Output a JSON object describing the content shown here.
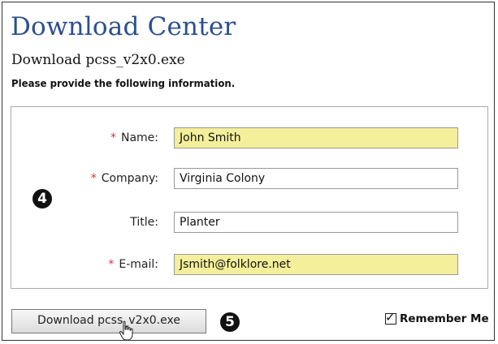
{
  "page": {
    "title": "Download Center",
    "subtitle": "Download pcss_v2x0.exe",
    "instruction": "Please provide the following information."
  },
  "form": {
    "required_marker": "*",
    "fields": [
      {
        "label": "Name:",
        "value": "John Smith",
        "required": true,
        "highlighted": true
      },
      {
        "label": "Company:",
        "value": "Virginia Colony",
        "required": true,
        "highlighted": false
      },
      {
        "label": "Title:",
        "value": "Planter",
        "required": false,
        "highlighted": false
      },
      {
        "label": "E-mail:",
        "value": "Jsmith@folklore.net",
        "required": true,
        "highlighted": true
      }
    ]
  },
  "actions": {
    "download_label": "Download pcss_v2x0.exe",
    "remember_label": "Remember Me",
    "remember_checked": true
  },
  "annotations": {
    "step_form": "4",
    "step_download": "5"
  },
  "colors": {
    "title": "#2c4f8f",
    "required": "#d9323a",
    "highlight": "#f4ef9a"
  }
}
